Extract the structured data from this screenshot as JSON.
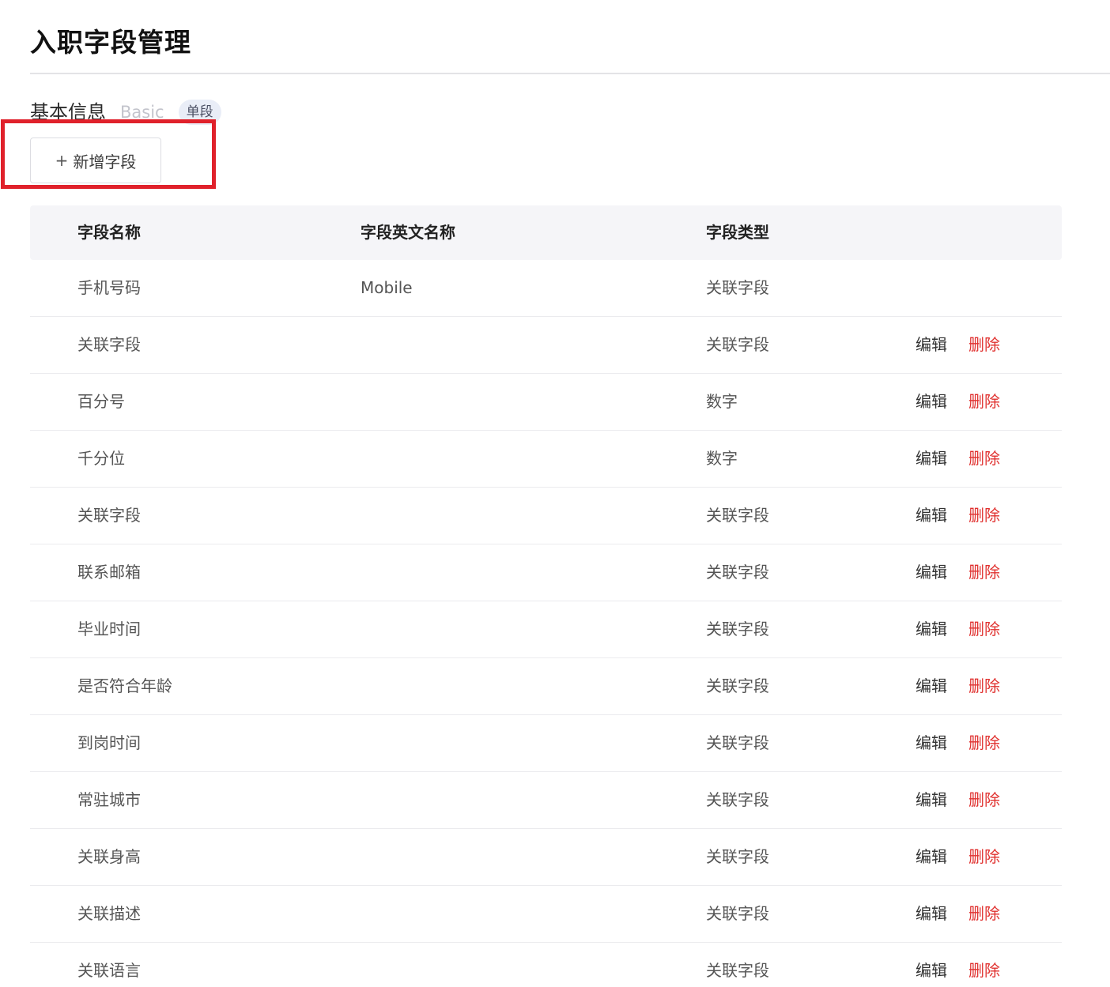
{
  "page": {
    "title": "入职字段管理"
  },
  "section": {
    "title": "基本信息",
    "subtitle": "Basic",
    "badge": "单段"
  },
  "add_button": {
    "icon": "plus-icon",
    "icon_glyph": "+",
    "label": "新增字段",
    "highlight_color": "#e0212b"
  },
  "table": {
    "headers": {
      "name": "字段名称",
      "english_name": "字段英文名称",
      "type": "字段类型"
    },
    "edit_label": "编辑",
    "delete_label": "删除",
    "delete_color": "#e0302e",
    "rows": [
      {
        "name": "手机号码",
        "english_name": "Mobile",
        "type": "关联字段",
        "actions": false
      },
      {
        "name": "关联字段",
        "english_name": "",
        "type": "关联字段",
        "actions": true
      },
      {
        "name": "百分号",
        "english_name": "",
        "type": "数字",
        "actions": true
      },
      {
        "name": "千分位",
        "english_name": "",
        "type": "数字",
        "actions": true
      },
      {
        "name": "关联字段",
        "english_name": "",
        "type": "关联字段",
        "actions": true
      },
      {
        "name": "联系邮箱",
        "english_name": "",
        "type": "关联字段",
        "actions": true
      },
      {
        "name": "毕业时间",
        "english_name": "",
        "type": "关联字段",
        "actions": true
      },
      {
        "name": "是否符合年龄",
        "english_name": "",
        "type": "关联字段",
        "actions": true
      },
      {
        "name": "到岗时间",
        "english_name": "",
        "type": "关联字段",
        "actions": true
      },
      {
        "name": "常驻城市",
        "english_name": "",
        "type": "关联字段",
        "actions": true
      },
      {
        "name": "关联身高",
        "english_name": "",
        "type": "关联字段",
        "actions": true
      },
      {
        "name": "关联描述",
        "english_name": "",
        "type": "关联字段",
        "actions": true
      },
      {
        "name": "关联语言",
        "english_name": "",
        "type": "关联字段",
        "actions": true
      }
    ]
  }
}
